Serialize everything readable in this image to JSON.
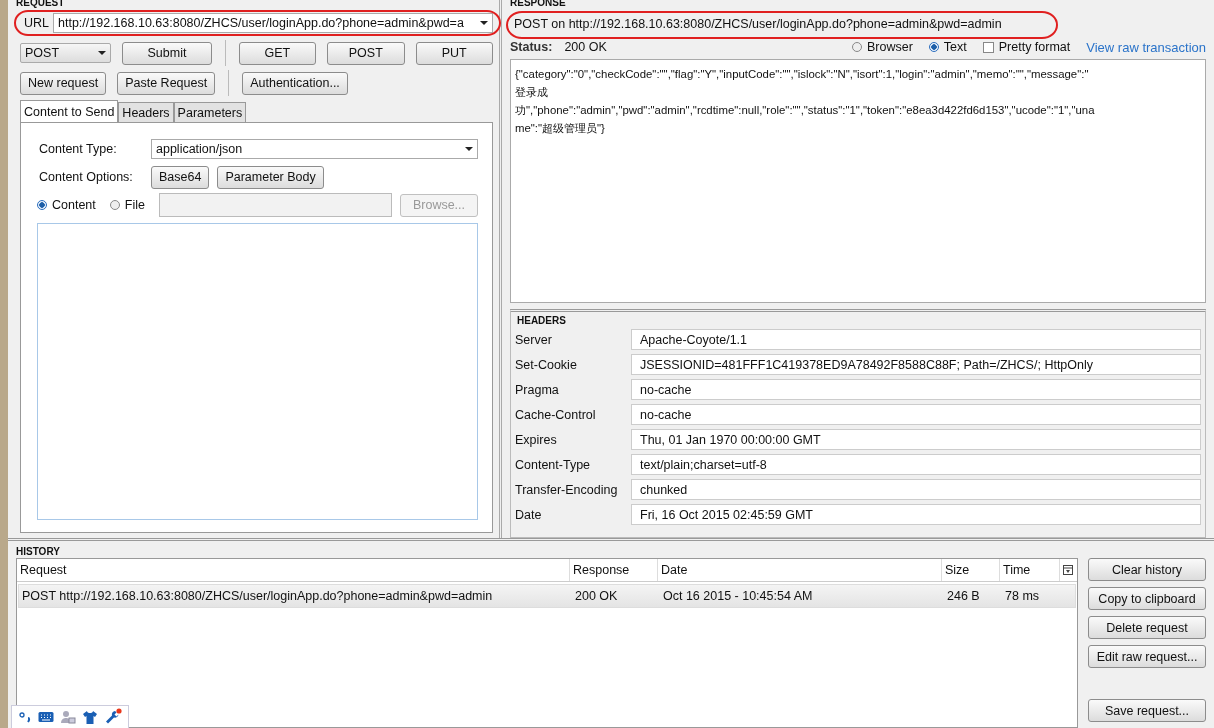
{
  "request": {
    "title": "REQUEST",
    "url_label": "URL",
    "url": "http://192.168.10.63:8080/ZHCS/user/loginApp.do?phone=admin&pwd=a",
    "method": "POST",
    "submit": "Submit",
    "quick_methods": [
      "GET",
      "POST",
      "PUT"
    ],
    "actions": [
      "New request",
      "Paste Request"
    ],
    "auth": "Authentication...",
    "tabs": [
      {
        "label": "Content to Send",
        "selected": true
      },
      {
        "label": "Headers",
        "selected": false
      },
      {
        "label": "Parameters",
        "selected": false
      }
    ],
    "content_type_label": "Content Type:",
    "content_type": "application/json",
    "content_options_label": "Content Options:",
    "options": [
      "Base64",
      "Parameter Body"
    ],
    "sources": [
      {
        "label": "Content",
        "selected": true
      },
      {
        "label": "File",
        "selected": false
      }
    ],
    "browse": {
      "label": "Browse...",
      "disabled": true
    }
  },
  "response": {
    "title": "RESPONSE",
    "summary": "POST on http://192.168.10.63:8080/ZHCS/user/loginApp.do?phone=admin&pwd=admin",
    "status_label": "Status:",
    "status": "200 OK",
    "views": [
      {
        "label": "Browser",
        "selected": false
      },
      {
        "label": "Text",
        "selected": true
      }
    ],
    "pretty": {
      "label": "Pretty format",
      "checked": false
    },
    "raw_link": "View raw transaction",
    "body_lines": [
      "{\"category\":\"0\",\"checkCode\":\"\",\"flag\":\"Y\",\"inputCode\":\"\",\"islock\":\"N\",\"isort\":1,\"login\":\"admin\",\"memo\":\"\",\"message\":\"",
      "登录成",
      "功\",\"phone\":\"admin\",\"pwd\":\"admin\",\"rcdtime\":null,\"role\":\"\",\"status\":\"1\",\"token\":\"e8ea3d422fd6d153\",\"ucode\":\"1\",\"una",
      "me\":\"超级管理员\"}"
    ]
  },
  "headers": {
    "title": "HEADERS",
    "rows": [
      {
        "name": "Server",
        "value": "Apache-Coyote/1.1"
      },
      {
        "name": "Set-Cookie",
        "value": "JSESSIONID=481FFF1C419378ED9A78492F8588C88F; Path=/ZHCS/; HttpOnly"
      },
      {
        "name": "Pragma",
        "value": "no-cache"
      },
      {
        "name": "Cache-Control",
        "value": "no-cache"
      },
      {
        "name": "Expires",
        "value": "Thu, 01 Jan 1970 00:00:00 GMT"
      },
      {
        "name": "Content-Type",
        "value": "text/plain;charset=utf-8"
      },
      {
        "name": "Transfer-Encoding",
        "value": "chunked"
      },
      {
        "name": "Date",
        "value": "Fri, 16 Oct 2015 02:45:59 GMT"
      }
    ]
  },
  "history": {
    "title": "HISTORY",
    "columns": [
      "Request",
      "Response",
      "Date",
      "Size",
      "Time"
    ],
    "rows": [
      {
        "cells": [
          "POST http://192.168.10.63:8080/ZHCS/user/loginApp.do?phone=admin&pwd=admin",
          "200 OK",
          "Oct 16 2015 - 10:45:54 AM",
          "246 B",
          "78 ms"
        ],
        "selected": true
      }
    ],
    "buttons": [
      "Clear history",
      "Copy to clipboard",
      "Delete request",
      "Edit raw request..."
    ],
    "save_button": "Save request..."
  }
}
